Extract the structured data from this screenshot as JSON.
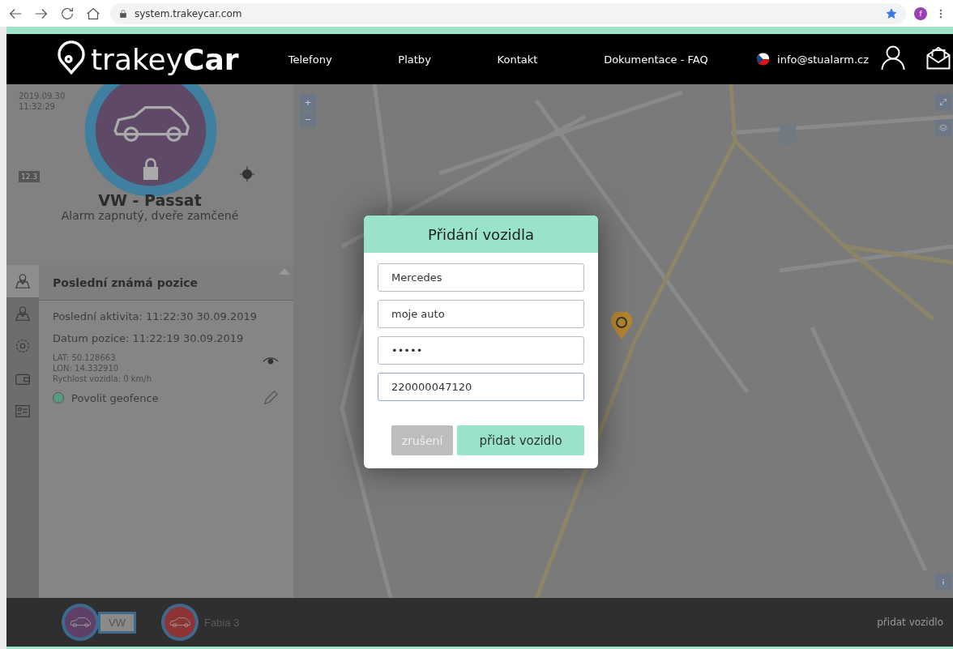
{
  "browser": {
    "url": "system.trakeycar.com",
    "profile": "f"
  },
  "header": {
    "logo_light": "trakey",
    "logo_bold": "Car",
    "nav": [
      "Telefony",
      "Platby",
      "Kontakt",
      "Dokumentace - FAQ"
    ],
    "email": "info@stualarm.cz"
  },
  "vehicle": {
    "date": "2019.09.30",
    "time": "11:32:29",
    "battery": "12.3",
    "name": "VW - Passat",
    "status": "Alarm zapnutý, dveře zamčené",
    "locked": true
  },
  "sidebar": {
    "items": [
      {
        "kind": "map",
        "selected": true
      },
      {
        "kind": "map",
        "selected": false
      },
      {
        "kind": "gear",
        "selected": false
      },
      {
        "kind": "wallet",
        "selected": false
      },
      {
        "kind": "card",
        "selected": false
      }
    ]
  },
  "position": {
    "title": "Poslední známá pozice",
    "activity": "Poslední aktivita: 11:22:30 30.09.2019",
    "date": "Datum pozice: 11:22:19 30.09.2019",
    "lat": "LAT: 50.128663",
    "lon": "LON: 14.332910",
    "speed": "Rychlost vozidla: 0 km/h",
    "geofence": {
      "label": "Povolit geofence",
      "on": true
    }
  },
  "map": {
    "zoom_in": "+",
    "zoom_out": "−"
  },
  "modal": {
    "title": "Přidání vozidla",
    "fields": [
      {
        "value": "Mercedes",
        "focused": false
      },
      {
        "value": "moje auto",
        "focused": false
      },
      {
        "value": "•••••",
        "focused": false
      },
      {
        "value": "220000047120",
        "focused": true
      }
    ],
    "cancel": "zrušení",
    "submit": "přidat vozidlo"
  },
  "vehicles": [
    {
      "label": "VW",
      "selected": true,
      "color": "#5e3f66"
    },
    {
      "label": "Fabia 3",
      "selected": false,
      "color": "#8e3434"
    }
  ],
  "add_vehicle": "přidat vozidlo"
}
